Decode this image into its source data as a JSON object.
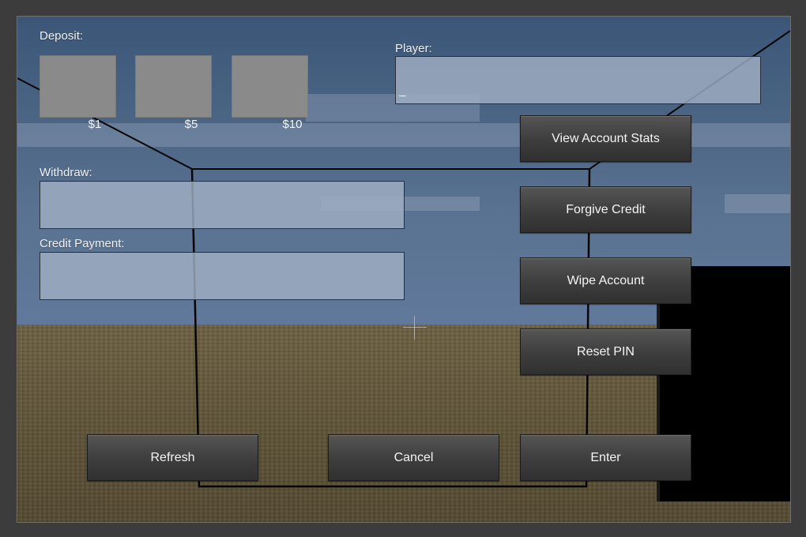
{
  "deposit": {
    "label": "Deposit:",
    "slots": [
      {
        "caption": "$1"
      },
      {
        "caption": "$5"
      },
      {
        "caption": "$10"
      }
    ]
  },
  "player": {
    "label": "Player:",
    "value": "_"
  },
  "withdraw": {
    "label": "Withdraw:",
    "value": ""
  },
  "credit_payment": {
    "label": "Credit Payment:",
    "value": ""
  },
  "actions": {
    "view_account_stats": "View Account Stats",
    "forgive_credit": "Forgive Credit",
    "wipe_account": "Wipe Account",
    "reset_pin": "Reset PIN"
  },
  "footer": {
    "refresh": "Refresh",
    "cancel": "Cancel",
    "enter": "Enter"
  },
  "colors": {
    "sky": "#5b7392",
    "ground": "#5c5236",
    "field_fill": "#a0afc3",
    "button_fill": "#3d3d3d",
    "slot_fill": "#8a8a8a"
  }
}
